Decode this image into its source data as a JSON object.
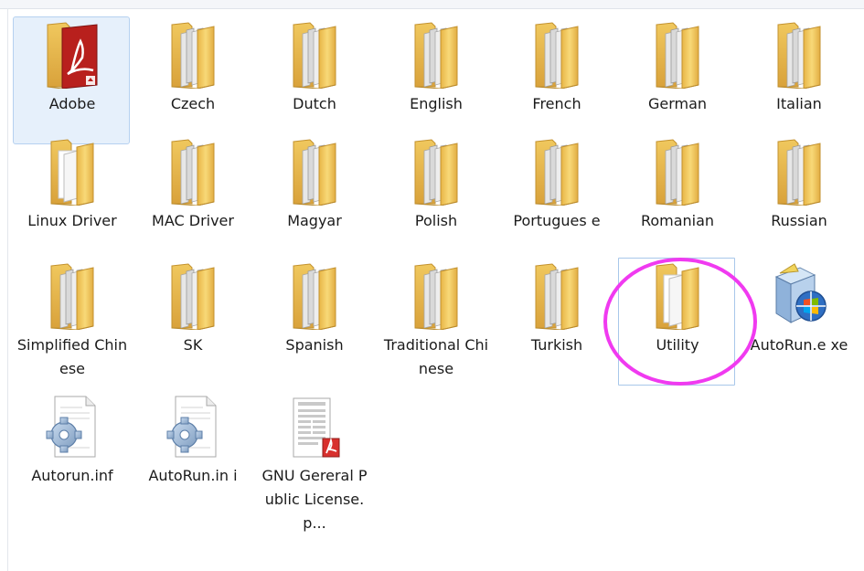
{
  "colors": {
    "folder": "#f5cd63",
    "folder_dark": "#dba93f",
    "selection": "#e6f0fb",
    "highlight": "#f03af0",
    "pdf_red": "#d8302d"
  },
  "items": [
    {
      "label": "Adobe",
      "icon": "adobe-folder-icon"
    },
    {
      "label": "Czech",
      "icon": "folder-icon"
    },
    {
      "label": "Dutch",
      "icon": "folder-icon"
    },
    {
      "label": "English",
      "icon": "folder-icon"
    },
    {
      "label": "French",
      "icon": "folder-icon"
    },
    {
      "label": "German",
      "icon": "folder-icon"
    },
    {
      "label": "Italian",
      "icon": "folder-icon"
    },
    {
      "label": "Linux Driver",
      "icon": "white-folder-icon"
    },
    {
      "label": "MAC Driver",
      "icon": "folder-icon"
    },
    {
      "label": "Magyar",
      "icon": "folder-icon"
    },
    {
      "label": "Polish",
      "icon": "folder-icon"
    },
    {
      "label": "Portugues e",
      "icon": "folder-icon"
    },
    {
      "label": "Romanian",
      "icon": "folder-icon"
    },
    {
      "label": "Russian",
      "icon": "folder-icon"
    },
    {
      "label": "Simplified Chinese",
      "icon": "folder-icon"
    },
    {
      "label": "SK",
      "icon": "folder-icon"
    },
    {
      "label": "Spanish",
      "icon": "folder-icon"
    },
    {
      "label": "Traditional Chinese",
      "icon": "folder-icon"
    },
    {
      "label": "Turkish",
      "icon": "folder-icon"
    },
    {
      "label": "Utility",
      "icon": "white-folder-icon"
    },
    {
      "label": "AutoRun.e xe",
      "icon": "installer-icon"
    },
    {
      "label": "Autorun.inf",
      "icon": "settings-file-icon"
    },
    {
      "label": "AutoRun.in i",
      "icon": "settings-file-icon"
    },
    {
      "label": "GNU Gereral Public License.p...",
      "icon": "pdf-document-icon"
    }
  ]
}
